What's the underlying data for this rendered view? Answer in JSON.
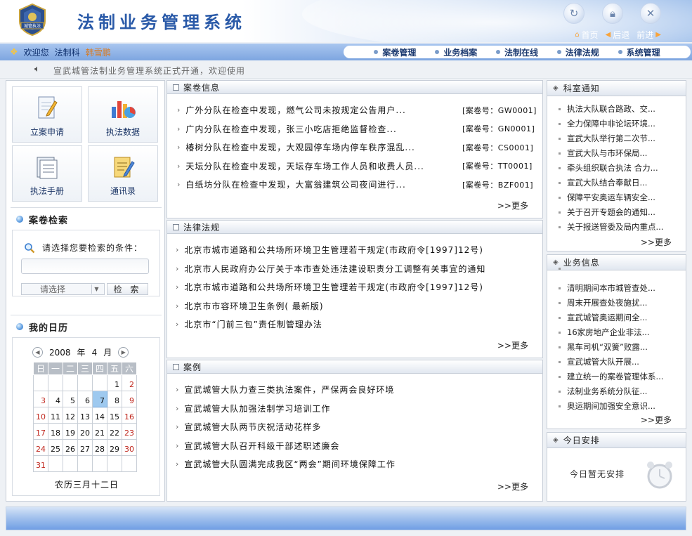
{
  "header": {
    "logo_text": "城管执法",
    "title": "法制业务管理系统",
    "nav": {
      "home": "首页",
      "back": "后退",
      "forward": "前进"
    }
  },
  "menubar": {
    "welcome": "欢迎您",
    "department": "法制科",
    "user": "韩雪鹏",
    "menu": [
      "案卷管理",
      "业务档案",
      "法制在线",
      "法律法规",
      "系统管理"
    ]
  },
  "notice": {
    "text": "宣武城管法制业务管理系统正式开通，欢迎使用"
  },
  "quick": {
    "apply": "立案申请",
    "data": "执法数据",
    "manual": "执法手册",
    "contacts": "通讯录"
  },
  "search": {
    "title": "案卷检索",
    "prompt": "请选择您要检索的条件：",
    "input_value": "",
    "select_value": "请选择",
    "button": "检 索"
  },
  "calendar": {
    "title": "我的日历",
    "year": "2008",
    "year_unit": "年",
    "month": "4",
    "month_unit": "月",
    "weekdays": [
      "日",
      "一",
      "二",
      "三",
      "四",
      "五",
      "六"
    ],
    "weeks": [
      [
        "",
        "",
        "",
        "",
        "",
        "1",
        "2"
      ],
      [
        "3",
        "4",
        "5",
        "6",
        "7",
        "8",
        "9"
      ],
      [
        "10",
        "11",
        "12",
        "13",
        "14",
        "15",
        "16"
      ],
      [
        "17",
        "18",
        "19",
        "20",
        "21",
        "22",
        "23"
      ],
      [
        "24",
        "25",
        "26",
        "27",
        "28",
        "29",
        "30"
      ],
      [
        "31",
        "",
        "",
        "",
        "",
        "",
        ""
      ]
    ],
    "today": "7",
    "lunar": "农历三月十二日"
  },
  "cases": {
    "title": "案卷信息",
    "more": ">>更多",
    "items": [
      {
        "text": "广外分队在检查中发现，燃气公司未按规定公告用户...",
        "code": "[案卷号：GW0001]"
      },
      {
        "text": "广内分队在检查中发现，张三小吃店拒绝监督检查...",
        "code": "[案卷号：GN0001]"
      },
      {
        "text": "椿树分队在检查中发现，大观园停车场内停车秩序混乱...",
        "code": "[案卷号：CS0001]"
      },
      {
        "text": "天坛分队在检查中发现，天坛存车场工作人员和收费人员...",
        "code": "[案卷号：TT0001]"
      },
      {
        "text": "白纸坊分队在检查中发现，大富翁建筑公司夜间进行...",
        "code": "[案卷号：BZF001]"
      }
    ]
  },
  "laws": {
    "title": "法律法规",
    "more": ">>更多",
    "items": [
      "北京市城市道路和公共场所环境卫生管理若干规定(市政府令[1997]12号)",
      "北京市人民政府办公厅关于本市查处违法建设职责分工调整有关事宜的通知",
      "北京市城市道路和公共场所环境卫生管理若干规定(市政府令[1997]12号)",
      "北京市市容环境卫生条例( 最新版)",
      "北京市“门前三包”责任制管理办法"
    ]
  },
  "examples": {
    "title": "案例",
    "more": ">>更多",
    "items": [
      "宣武城管大队力查三类执法案件，严保两会良好环境",
      "宣武城管大队加强法制学习培训工作",
      "宣武城管大队两节庆祝活动花样多",
      "宣武城管大队召开科级干部述职述廉会",
      "宣武城管大队圆满完成我区“两会”期间环境保障工作"
    ]
  },
  "office_notice": {
    "title": "科室通知",
    "more": ">>更多",
    "items": [
      "执法大队联合路政、交...",
      "全力保障中非论坛环境...",
      "宣武大队举行第二次节...",
      "宣武大队与市环保局...",
      "牵头组织联合执法 合力...",
      "宣武大队结合奉献日...",
      "保障平安奥运车辆安全...",
      "关于召开专题会的通知...",
      "关于报送管委及局内重点..."
    ]
  },
  "business_info": {
    "title": "业务信息",
    "more": ">>更多",
    "items": [
      "",
      "清明期间本市城管查处...",
      "周末开展查处夜施扰...",
      "宣武城管奥运期间全...",
      "16家房地产企业非法...",
      "黑车司机“双簧”败露...",
      "宣武城管大队开展...",
      "建立统一的案卷管理体系...",
      "法制业务系统分队征...",
      "奥运期间加强安全意识..."
    ]
  },
  "today_schedule": {
    "title": "今日安排",
    "empty_text": "今日暂无安排"
  }
}
